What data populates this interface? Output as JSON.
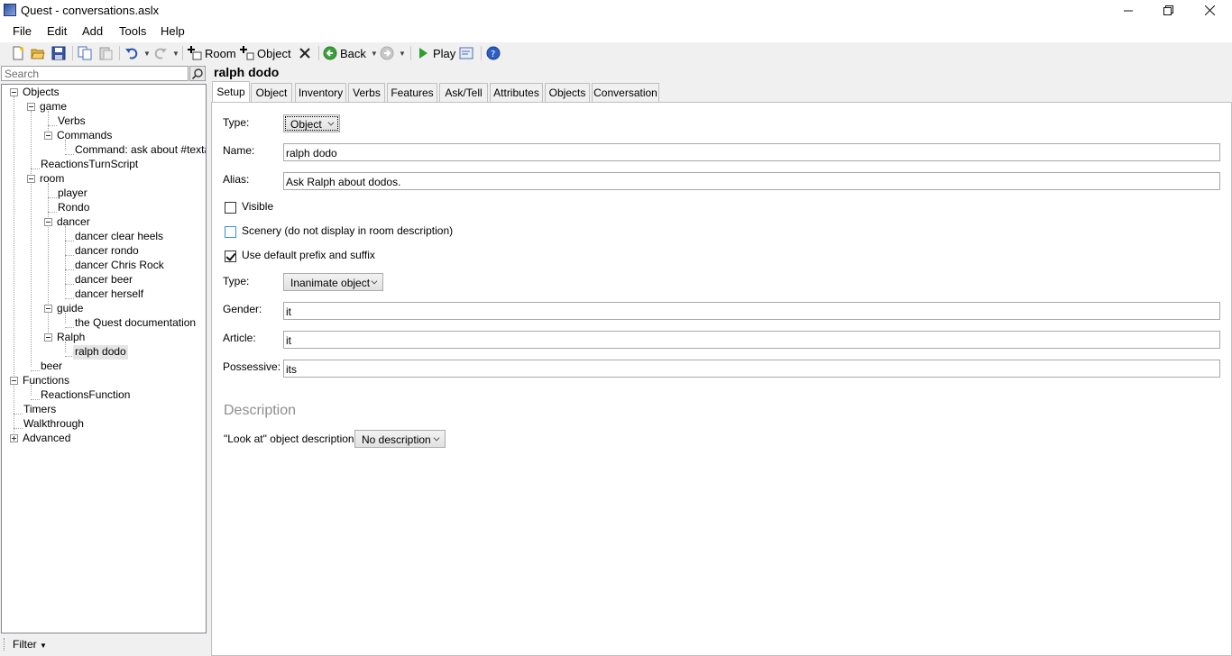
{
  "window": {
    "title": "Quest - conversations.aslx"
  },
  "menu": [
    "File",
    "Edit",
    "Add",
    "Tools",
    "Help"
  ],
  "toolbar": {
    "room_label": "Room",
    "object_label": "Object",
    "back_label": "Back",
    "play_label": "Play"
  },
  "search": {
    "placeholder": "Search"
  },
  "tree": [
    "Objects",
    "game",
    "Verbs",
    "Commands",
    "Command: ask about #text#",
    "ReactionsTurnScript",
    "room",
    "player",
    "Rondo",
    "dancer",
    "dancer clear heels",
    "dancer rondo",
    "dancer Chris Rock",
    "dancer beer",
    "dancer herself",
    "guide",
    "the Quest documentation",
    "Ralph",
    "ralph dodo",
    "beer",
    "Functions",
    "ReactionsFunction",
    "Timers",
    "Walkthrough",
    "Advanced"
  ],
  "statusbar": {
    "filter_label": "Filter"
  },
  "editor": {
    "title": "ralph dodo",
    "tabs": [
      "Setup",
      "Object",
      "Inventory",
      "Verbs",
      "Features",
      "Ask/Tell",
      "Attributes",
      "Objects",
      "Conversation"
    ],
    "type_label": "Type:",
    "type_value": "Object",
    "name_label": "Name:",
    "name_value": "ralph dodo",
    "alias_label": "Alias:",
    "alias_value": "Ask Ralph about dodos.",
    "visible_label": "Visible",
    "visible_checked": false,
    "scenery_label": "Scenery (do not display in room description)",
    "scenery_checked": false,
    "prefix_label": "Use default prefix and suffix",
    "prefix_checked": true,
    "type2_label": "Type:",
    "type2_value": "Inanimate object",
    "gender_label": "Gender:",
    "gender_value": "it",
    "article_label": "Article:",
    "article_value": "it",
    "possessive_label": "Possessive:",
    "possessive_value": "its",
    "description_heading": "Description",
    "look_label": "\"Look at\" object description:",
    "look_value": "No description"
  },
  "colors": {
    "accent": "#3b8fd6",
    "play_green": "#2e9e2e",
    "back_green": "#3aa23a"
  }
}
